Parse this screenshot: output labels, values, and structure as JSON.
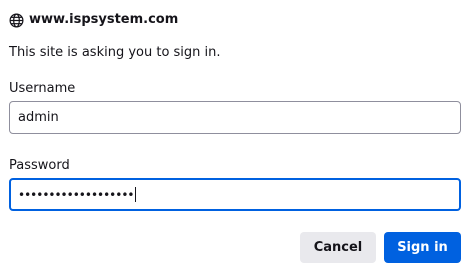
{
  "dialog": {
    "site": "www.ispsystem.com",
    "message": "This site is asking you to sign in.",
    "username_label": "Username",
    "username_value": "admin",
    "password_label": "Password",
    "password_masked": "•••••••••••••••••••",
    "cancel_label": "Cancel",
    "signin_label": "Sign in"
  },
  "icons": {
    "site": "globe-icon"
  },
  "colors": {
    "primary": "#0061e0",
    "secondary_button": "#e9e9ed",
    "text": "#15141a"
  }
}
